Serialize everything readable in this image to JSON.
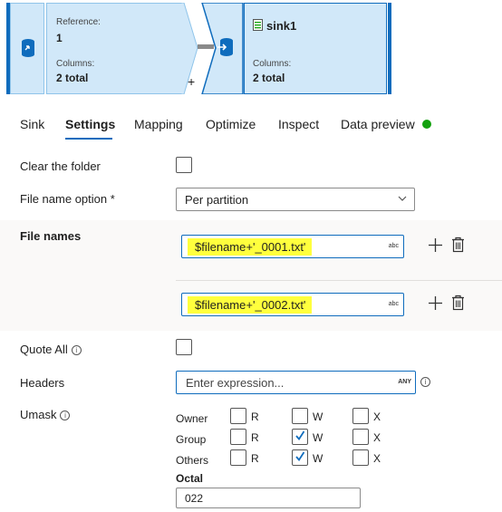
{
  "flow": {
    "source": {
      "reference_label": "Reference:",
      "reference_value": "1",
      "columns_label": "Columns:",
      "columns_value": "2 total"
    },
    "sink": {
      "title": "sink1",
      "columns_label": "Columns:",
      "columns_value": "2 total"
    },
    "add_label": "+"
  },
  "tabs": [
    {
      "label": "Sink"
    },
    {
      "label": "Settings"
    },
    {
      "label": "Mapping"
    },
    {
      "label": "Optimize"
    },
    {
      "label": "Inspect"
    },
    {
      "label": "Data preview"
    }
  ],
  "active_tab": "Settings",
  "colors": {
    "accent": "#0f6cbd",
    "node_fill": "#d1e8f9",
    "highlight": "#ffff3d",
    "status_ok": "#13a10e"
  },
  "form": {
    "clear_folder": {
      "label": "Clear the folder",
      "checked": false
    },
    "file_name_option": {
      "label": "File name option *",
      "value": "Per partition"
    },
    "file_names": {
      "label": "File names",
      "entries": [
        {
          "value": "$filename+'_0001.txt'",
          "type": "abc"
        },
        {
          "value": "$filename+'_0002.txt'",
          "type": "abc"
        }
      ]
    },
    "quote_all": {
      "label": "Quote All",
      "checked": false
    },
    "headers": {
      "label": "Headers",
      "placeholder": "Enter expression...",
      "type": "ANY"
    },
    "umask": {
      "label": "Umask",
      "rows": [
        {
          "name": "Owner",
          "r": false,
          "w": false,
          "x": false
        },
        {
          "name": "Group",
          "r": false,
          "w": true,
          "x": false
        },
        {
          "name": "Others",
          "r": false,
          "w": true,
          "x": false
        }
      ],
      "letters": {
        "r": "R",
        "w": "W",
        "x": "X"
      },
      "octal_label": "Octal",
      "octal_value": "022"
    }
  }
}
